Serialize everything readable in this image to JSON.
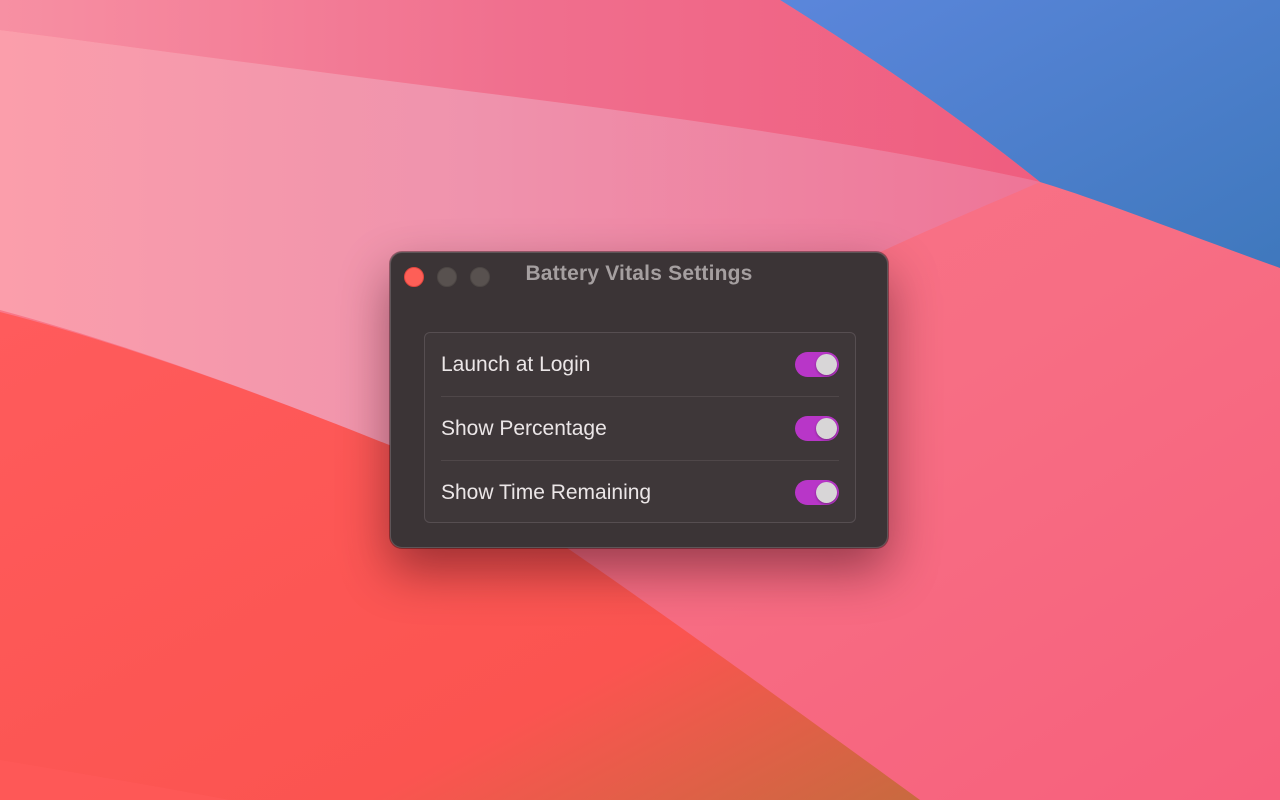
{
  "window": {
    "title": "Battery Vitals Settings"
  },
  "settings": [
    {
      "label": "Launch at Login",
      "enabled": true
    },
    {
      "label": "Show Percentage",
      "enabled": true
    },
    {
      "label": "Show Time Remaining",
      "enabled": true
    }
  ],
  "colors": {
    "toggle_on": "#b836c8",
    "window_bg": "#3b3436",
    "close_button": "#fe5f57"
  },
  "icons": {
    "close": "close-icon",
    "minimize": "minimize-icon",
    "zoom": "zoom-icon"
  }
}
